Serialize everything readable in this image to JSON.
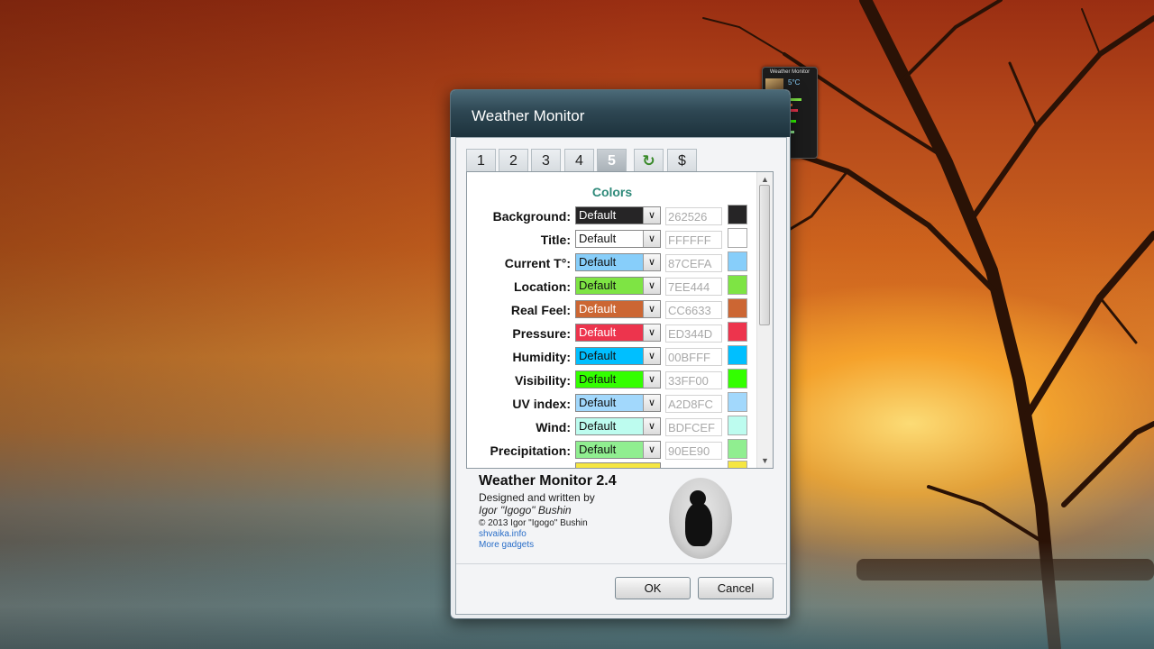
{
  "gadget": {
    "title": "Weather Monitor",
    "temperature": "5°C"
  },
  "dialog": {
    "title": "Weather Monitor",
    "tabs": [
      {
        "label": "1",
        "active": false
      },
      {
        "label": "2",
        "active": false
      },
      {
        "label": "3",
        "active": false
      },
      {
        "label": "4",
        "active": false
      },
      {
        "label": "5",
        "active": true
      },
      {
        "label": "↻",
        "active": false,
        "icon": "refresh-icon"
      },
      {
        "label": "$",
        "active": false
      }
    ],
    "colors_heading": "Colors",
    "rows": [
      {
        "label": "Background:",
        "option": "Default",
        "hex": "262526",
        "swatch": "#262526",
        "text_color": "#ffffff"
      },
      {
        "label": "Title:",
        "option": "Default",
        "hex": "FFFFFF",
        "swatch": "#FFFFFF",
        "text_color": "#111111"
      },
      {
        "label": "Current T°:",
        "option": "Default",
        "hex": "87CEFA",
        "swatch": "#87CEFA",
        "text_color": "#111111"
      },
      {
        "label": "Location:",
        "option": "Default",
        "hex": "7EE444",
        "swatch": "#7EE444",
        "text_color": "#111111"
      },
      {
        "label": "Real Feel:",
        "option": "Default",
        "hex": "CC6633",
        "swatch": "#CC6633",
        "text_color": "#ffffff"
      },
      {
        "label": "Pressure:",
        "option": "Default",
        "hex": "ED344D",
        "swatch": "#ED344D",
        "text_color": "#ffffff"
      },
      {
        "label": "Humidity:",
        "option": "Default",
        "hex": "00BFFF",
        "swatch": "#00BFFF",
        "text_color": "#111111"
      },
      {
        "label": "Visibility:",
        "option": "Default",
        "hex": "33FF00",
        "swatch": "#33FF00",
        "text_color": "#111111"
      },
      {
        "label": "UV index:",
        "option": "Default",
        "hex": "A2D8FC",
        "swatch": "#A2D8FC",
        "text_color": "#111111"
      },
      {
        "label": "Wind:",
        "option": "Default",
        "hex": "BDFCEF",
        "swatch": "#BDFCEF",
        "text_color": "#111111"
      },
      {
        "label": "Precipitation:",
        "option": "Default",
        "hex": "90EE90",
        "swatch": "#90EE90",
        "text_color": "#111111"
      }
    ],
    "about": {
      "app_name": "Weather Monitor 2.4",
      "designed_by": "Designed and written by",
      "author": "Igor \"Igogo\" Bushin",
      "copyright": "© 2013 Igor \"Igogo\" Bushin",
      "site_link": "shvaika.info",
      "more_link": "More gadgets"
    },
    "ok_label": "OK",
    "cancel_label": "Cancel"
  }
}
